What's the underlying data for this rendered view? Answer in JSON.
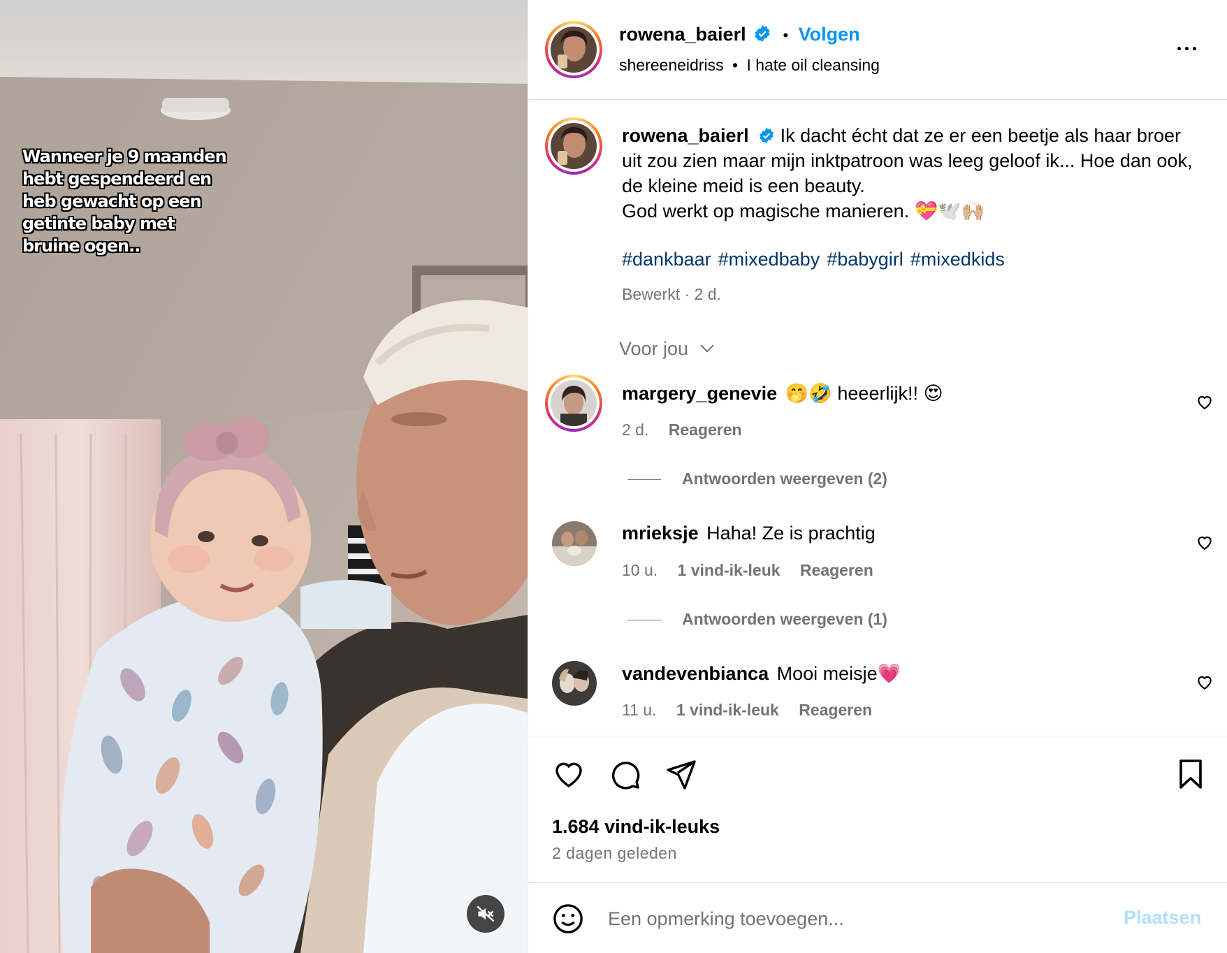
{
  "media": {
    "overlay_text": "Wanneer je 9 maanden hebt gespendeerd en heb gewacht op een getinte baby met bruine ogen..",
    "mute_icon": "speaker-muted-icon"
  },
  "header": {
    "username": "rowena_baierl",
    "separator": "•",
    "follow_label": "Volgen",
    "audio_artist": "shereeneidriss",
    "audio_separator": "•",
    "audio_title": "I hate oil cleansing",
    "more_icon": "more-options-icon"
  },
  "caption": {
    "username": "rowena_baierl",
    "text": "Ik dacht écht dat ze er een beetje als haar broer uit zou zien maar mijn inktpatroon was leeg geloof ik... Hoe dan ook, de kleine meid is een beauty.",
    "line2": "God werkt op magische manieren. 💝🕊️🙌🏼",
    "hashtags": [
      "#dankbaar",
      "#mixedbaby",
      "#babygirl",
      "#mixedkids"
    ],
    "meta": "Bewerkt · 2 d."
  },
  "sort_label": "Voor jou",
  "comments": [
    {
      "username": "margery_genevie",
      "text": "🤭🤣 heeerlijk!! 😍",
      "time": "2 d.",
      "likes": "",
      "reply_label": "Reageren",
      "view_replies": "Antwoorden weergeven (2)"
    },
    {
      "username": "mrieksje",
      "text": "Haha! Ze is prachtig",
      "time": "10 u.",
      "likes": "1 vind-ik-leuk",
      "reply_label": "Reageren",
      "view_replies": "Antwoorden weergeven (1)"
    },
    {
      "username": "vandevenbianca",
      "text": "Mooi meisje💗",
      "time": "11 u.",
      "likes": "1 vind-ik-leuk",
      "reply_label": "Reageren",
      "view_replies": ""
    }
  ],
  "actions": {
    "likes_count": "1.684 vind-ik-leuks",
    "posted_ago": "2 dagen geleden"
  },
  "composer": {
    "placeholder": "Een opmerking toevoegen...",
    "post_label": "Plaatsen"
  },
  "colors": {
    "link_blue": "#0095f6",
    "hashtag_blue": "#00376b",
    "muted_gray": "#737373",
    "post_disabled": "#b2dffc"
  }
}
